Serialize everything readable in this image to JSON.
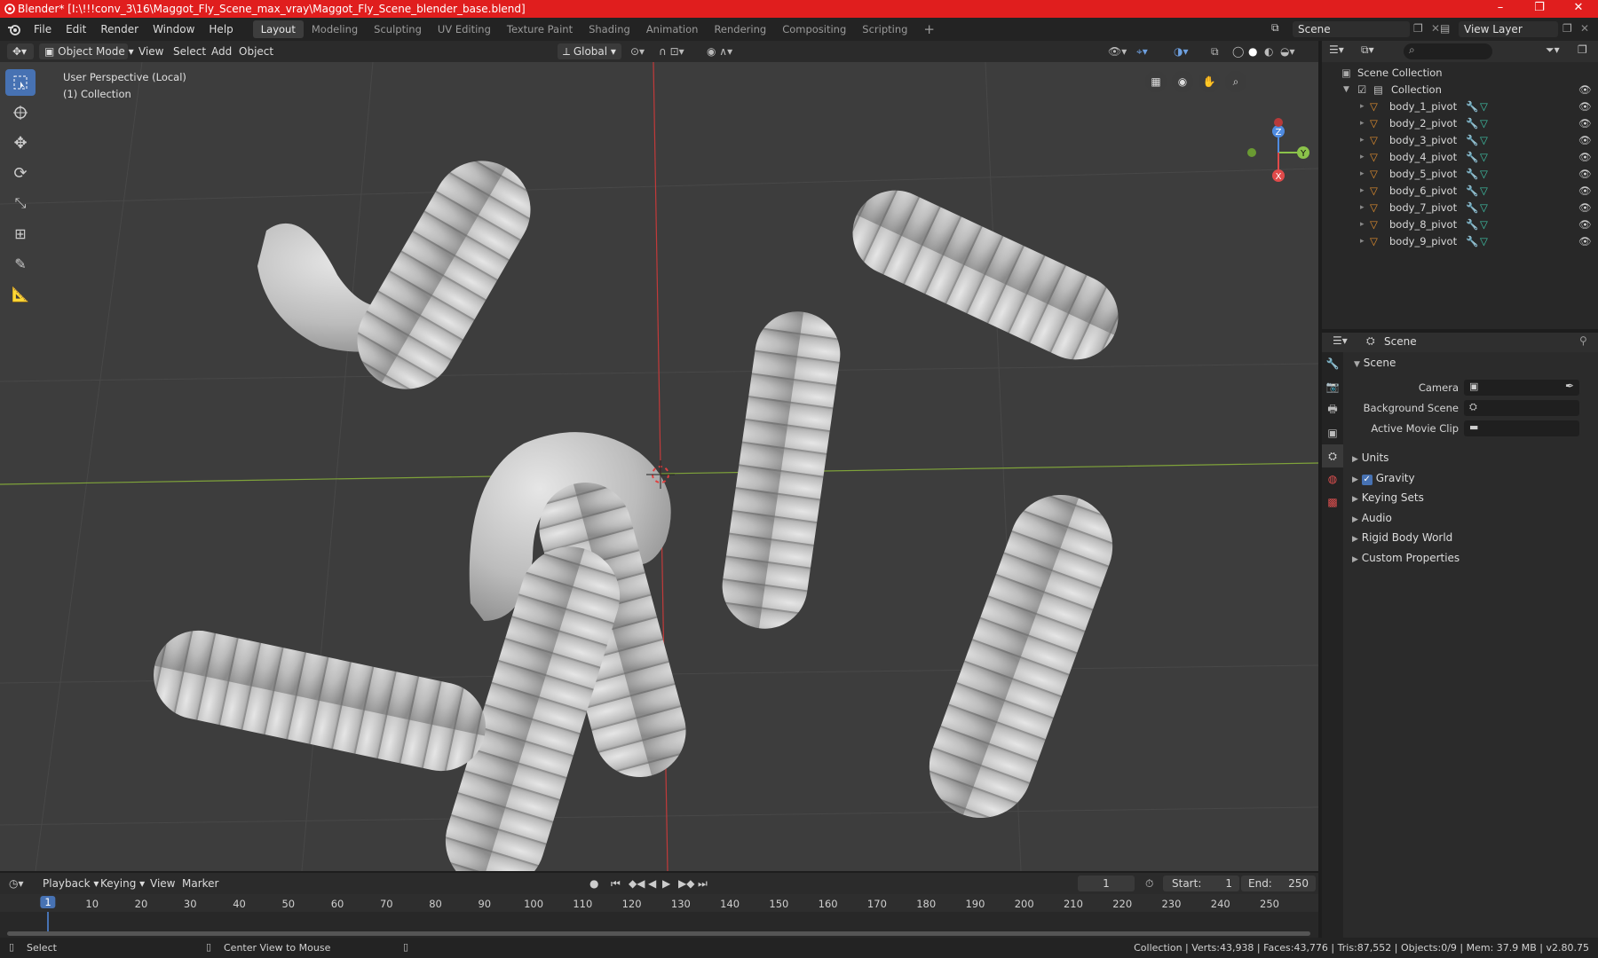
{
  "window": {
    "title": "Blender* [I:\\!!!conv_3\\16\\Maggot_Fly_Scene_max_vray\\Maggot_Fly_Scene_blender_base.blend]",
    "minimize": "–",
    "maximize": "❐",
    "close": "✕"
  },
  "menu": [
    "File",
    "Edit",
    "Render",
    "Window",
    "Help"
  ],
  "workspaces": [
    "Layout",
    "Modeling",
    "Sculpting",
    "UV Editing",
    "Texture Paint",
    "Shading",
    "Animation",
    "Rendering",
    "Compositing",
    "Scripting"
  ],
  "active_workspace": "Layout",
  "scene": {
    "label": "Scene",
    "view_layer": "View Layer"
  },
  "viewport_header": {
    "mode": "Object Mode",
    "view": "View",
    "select": "Select",
    "add": "Add",
    "object": "Object",
    "orientation": "Global"
  },
  "viewport": {
    "perspective": "User Perspective (Local)",
    "collection": "(1) Collection",
    "axis_x": "X",
    "axis_y": "Y",
    "axis_z": "Z"
  },
  "outliner": {
    "root": "Scene Collection",
    "collection": "Collection",
    "objects": [
      "body_1_pivot",
      "body_2_pivot",
      "body_3_pivot",
      "body_4_pivot",
      "body_5_pivot",
      "body_6_pivot",
      "body_7_pivot",
      "body_8_pivot",
      "body_9_pivot"
    ]
  },
  "properties": {
    "header": "Scene",
    "panel": "Scene",
    "camera_label": "Camera",
    "bg_scene_label": "Background Scene",
    "movie_clip_label": "Active Movie Clip",
    "sections": [
      "Units",
      "Gravity",
      "Keying Sets",
      "Audio",
      "Rigid Body World",
      "Custom Properties"
    ],
    "gravity_checked": true
  },
  "timeline": {
    "playback": "Playback",
    "keying": "Keying",
    "view": "View",
    "marker": "Marker",
    "current_frame": "1",
    "start_label": "Start:",
    "start": "1",
    "end_label": "End:",
    "end": "250",
    "ticks": [
      "1",
      "10",
      "20",
      "30",
      "40",
      "50",
      "60",
      "70",
      "80",
      "90",
      "100",
      "110",
      "120",
      "130",
      "140",
      "150",
      "160",
      "170",
      "180",
      "190",
      "200",
      "210",
      "220",
      "230",
      "240",
      "250"
    ]
  },
  "status": {
    "select": "Select",
    "center": "Center View to Mouse",
    "stats": "Collection | Verts:43,938 | Faces:43,776 | Tris:87,552 | Objects:0/9 | Mem: 37.9 MB | v2.80.75"
  },
  "colors": {
    "title_bar": "#e01e1e",
    "accent": "#4772b3",
    "mesh_icon": "#e08e2f",
    "data_icon": "#3fc4a8"
  }
}
